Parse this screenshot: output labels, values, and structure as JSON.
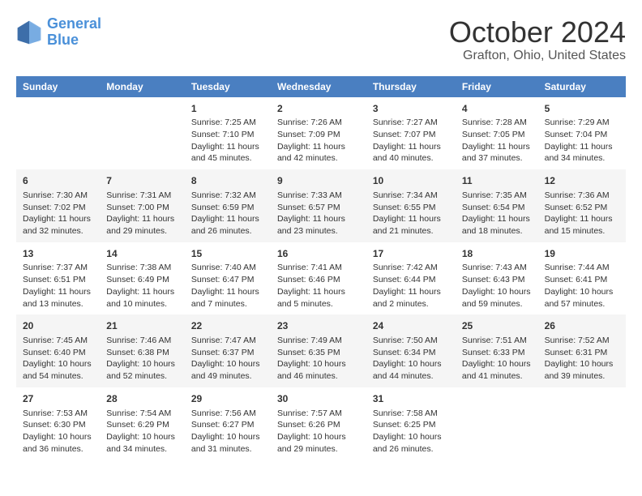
{
  "logo": {
    "line1": "General",
    "line2": "Blue"
  },
  "title": "October 2024",
  "subtitle": "Grafton, Ohio, United States",
  "weekdays": [
    "Sunday",
    "Monday",
    "Tuesday",
    "Wednesday",
    "Thursday",
    "Friday",
    "Saturday"
  ],
  "rows": [
    [
      {
        "day": "",
        "content": ""
      },
      {
        "day": "",
        "content": ""
      },
      {
        "day": "1",
        "content": "Sunrise: 7:25 AM\nSunset: 7:10 PM\nDaylight: 11 hours and 45 minutes."
      },
      {
        "day": "2",
        "content": "Sunrise: 7:26 AM\nSunset: 7:09 PM\nDaylight: 11 hours and 42 minutes."
      },
      {
        "day": "3",
        "content": "Sunrise: 7:27 AM\nSunset: 7:07 PM\nDaylight: 11 hours and 40 minutes."
      },
      {
        "day": "4",
        "content": "Sunrise: 7:28 AM\nSunset: 7:05 PM\nDaylight: 11 hours and 37 minutes."
      },
      {
        "day": "5",
        "content": "Sunrise: 7:29 AM\nSunset: 7:04 PM\nDaylight: 11 hours and 34 minutes."
      }
    ],
    [
      {
        "day": "6",
        "content": "Sunrise: 7:30 AM\nSunset: 7:02 PM\nDaylight: 11 hours and 32 minutes."
      },
      {
        "day": "7",
        "content": "Sunrise: 7:31 AM\nSunset: 7:00 PM\nDaylight: 11 hours and 29 minutes."
      },
      {
        "day": "8",
        "content": "Sunrise: 7:32 AM\nSunset: 6:59 PM\nDaylight: 11 hours and 26 minutes."
      },
      {
        "day": "9",
        "content": "Sunrise: 7:33 AM\nSunset: 6:57 PM\nDaylight: 11 hours and 23 minutes."
      },
      {
        "day": "10",
        "content": "Sunrise: 7:34 AM\nSunset: 6:55 PM\nDaylight: 11 hours and 21 minutes."
      },
      {
        "day": "11",
        "content": "Sunrise: 7:35 AM\nSunset: 6:54 PM\nDaylight: 11 hours and 18 minutes."
      },
      {
        "day": "12",
        "content": "Sunrise: 7:36 AM\nSunset: 6:52 PM\nDaylight: 11 hours and 15 minutes."
      }
    ],
    [
      {
        "day": "13",
        "content": "Sunrise: 7:37 AM\nSunset: 6:51 PM\nDaylight: 11 hours and 13 minutes."
      },
      {
        "day": "14",
        "content": "Sunrise: 7:38 AM\nSunset: 6:49 PM\nDaylight: 11 hours and 10 minutes."
      },
      {
        "day": "15",
        "content": "Sunrise: 7:40 AM\nSunset: 6:47 PM\nDaylight: 11 hours and 7 minutes."
      },
      {
        "day": "16",
        "content": "Sunrise: 7:41 AM\nSunset: 6:46 PM\nDaylight: 11 hours and 5 minutes."
      },
      {
        "day": "17",
        "content": "Sunrise: 7:42 AM\nSunset: 6:44 PM\nDaylight: 11 hours and 2 minutes."
      },
      {
        "day": "18",
        "content": "Sunrise: 7:43 AM\nSunset: 6:43 PM\nDaylight: 10 hours and 59 minutes."
      },
      {
        "day": "19",
        "content": "Sunrise: 7:44 AM\nSunset: 6:41 PM\nDaylight: 10 hours and 57 minutes."
      }
    ],
    [
      {
        "day": "20",
        "content": "Sunrise: 7:45 AM\nSunset: 6:40 PM\nDaylight: 10 hours and 54 minutes."
      },
      {
        "day": "21",
        "content": "Sunrise: 7:46 AM\nSunset: 6:38 PM\nDaylight: 10 hours and 52 minutes."
      },
      {
        "day": "22",
        "content": "Sunrise: 7:47 AM\nSunset: 6:37 PM\nDaylight: 10 hours and 49 minutes."
      },
      {
        "day": "23",
        "content": "Sunrise: 7:49 AM\nSunset: 6:35 PM\nDaylight: 10 hours and 46 minutes."
      },
      {
        "day": "24",
        "content": "Sunrise: 7:50 AM\nSunset: 6:34 PM\nDaylight: 10 hours and 44 minutes."
      },
      {
        "day": "25",
        "content": "Sunrise: 7:51 AM\nSunset: 6:33 PM\nDaylight: 10 hours and 41 minutes."
      },
      {
        "day": "26",
        "content": "Sunrise: 7:52 AM\nSunset: 6:31 PM\nDaylight: 10 hours and 39 minutes."
      }
    ],
    [
      {
        "day": "27",
        "content": "Sunrise: 7:53 AM\nSunset: 6:30 PM\nDaylight: 10 hours and 36 minutes."
      },
      {
        "day": "28",
        "content": "Sunrise: 7:54 AM\nSunset: 6:29 PM\nDaylight: 10 hours and 34 minutes."
      },
      {
        "day": "29",
        "content": "Sunrise: 7:56 AM\nSunset: 6:27 PM\nDaylight: 10 hours and 31 minutes."
      },
      {
        "day": "30",
        "content": "Sunrise: 7:57 AM\nSunset: 6:26 PM\nDaylight: 10 hours and 29 minutes."
      },
      {
        "day": "31",
        "content": "Sunrise: 7:58 AM\nSunset: 6:25 PM\nDaylight: 10 hours and 26 minutes."
      },
      {
        "day": "",
        "content": ""
      },
      {
        "day": "",
        "content": ""
      }
    ]
  ]
}
